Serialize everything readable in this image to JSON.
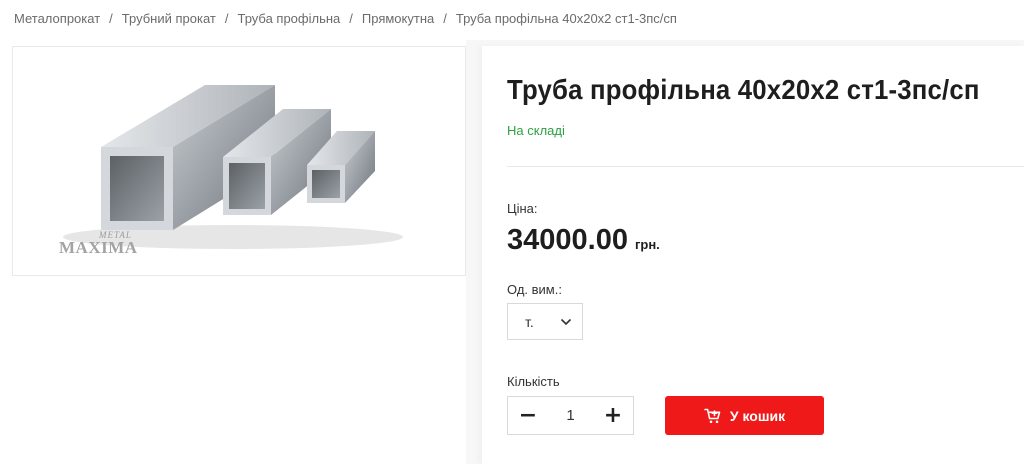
{
  "breadcrumb": [
    {
      "label": "Металопрокат"
    },
    {
      "label": "Трубний прокат"
    },
    {
      "label": "Труба профільна"
    },
    {
      "label": "Прямокутна"
    },
    {
      "label": "Труба профільна 40х20х2 ст1-3пс/сп"
    }
  ],
  "breadcrumb_separator": "/",
  "gallery": {
    "image_icon": "rectangular-steel-tubes-image",
    "watermark_top": "METAL",
    "watermark_bottom": "MAXIMA"
  },
  "product": {
    "title": "Труба профільна 40х20х2 ст1-3пс/сп",
    "stock_status": "На складі",
    "price_label": "Ціна:",
    "price_value": "34000.00",
    "currency": "грн.",
    "unit_label": "Од. вим.:",
    "unit_selected": "т.",
    "quantity_label": "Кількість",
    "quantity_value": "1",
    "minus_symbol": "−",
    "plus_symbol": "+",
    "cart_button_label": "У кошик"
  },
  "colors": {
    "accent_red": "#f01919",
    "stock_green": "#2ea043",
    "text_dark": "#1e1e1e",
    "breadcrumb_gray": "#6b6b6b"
  }
}
